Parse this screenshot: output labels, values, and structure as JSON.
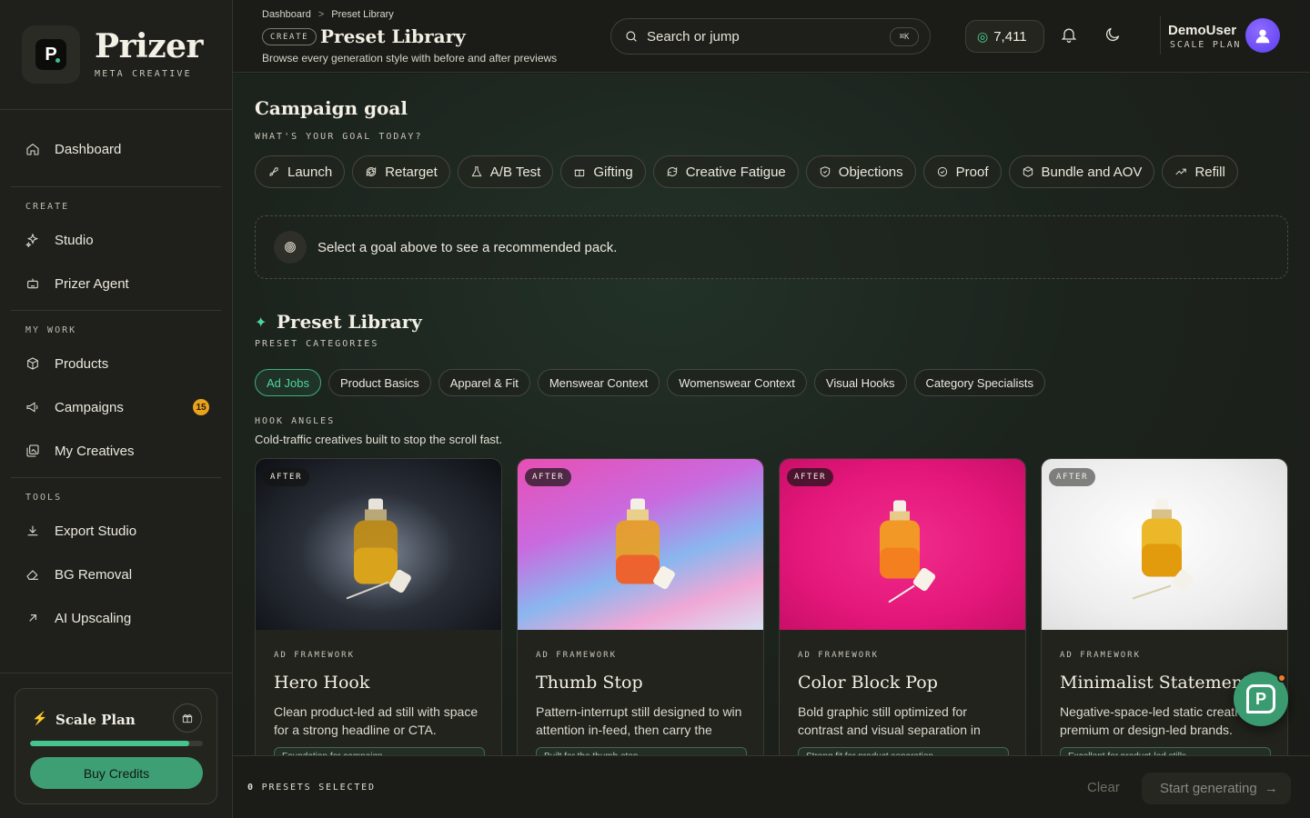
{
  "brand": {
    "name": "Prizer",
    "subtitle": "META CREATIVE",
    "logo_letter": "P"
  },
  "sidebar": {
    "dashboard": "Dashboard",
    "sections": [
      {
        "label": "CREATE",
        "items": [
          {
            "label": "Studio",
            "icon": "sparkle-icon"
          },
          {
            "label": "Prizer Agent",
            "icon": "robot-icon"
          }
        ]
      },
      {
        "label": "MY WORK",
        "items": [
          {
            "label": "Products",
            "icon": "box-icon"
          },
          {
            "label": "Campaigns",
            "icon": "megaphone-icon",
            "badge": "15"
          },
          {
            "label": "My Creatives",
            "icon": "gallery-icon"
          }
        ]
      },
      {
        "label": "TOOLS",
        "items": [
          {
            "label": "Export Studio",
            "icon": "download-icon"
          },
          {
            "label": "BG Removal",
            "icon": "eraser-icon"
          },
          {
            "label": "AI Upscaling",
            "icon": "arrow-up-right-icon"
          }
        ]
      }
    ],
    "plan": {
      "name": "Scale Plan",
      "progress_percent": 92,
      "buy_label": "Buy Credits"
    }
  },
  "header": {
    "breadcrumbs": [
      "Dashboard",
      "Preset Library"
    ],
    "breadcrumb_sep": ">",
    "pill": "CREATE",
    "title": "Preset Library",
    "subtitle": "Browse every generation style with before and after previews",
    "search_placeholder": "Search or jump",
    "shortcut": "⌘K",
    "credits": "7,411",
    "user_name": "DemoUser",
    "user_plan": "SCALE PLAN"
  },
  "goal": {
    "title": "Campaign goal",
    "caption": "WHAT'S YOUR GOAL TODAY?",
    "options": [
      "Launch",
      "Retarget",
      "A/B Test",
      "Gifting",
      "Creative Fatigue",
      "Objections",
      "Proof",
      "Bundle and AOV",
      "Refill"
    ],
    "hint": "Select a goal above to see a recommended pack."
  },
  "library": {
    "title": "Preset Library",
    "caption": "PRESET CATEGORIES",
    "categories": [
      "Ad Jobs",
      "Product Basics",
      "Apparel & Fit",
      "Menswear Context",
      "Womenswear Context",
      "Visual Hooks",
      "Category Specialists"
    ],
    "active_category": "Ad Jobs",
    "group_caption": "HOOK ANGLES",
    "group_desc": "Cold-traffic creatives built to stop the scroll fast.",
    "cards": [
      {
        "badge": "AFTER",
        "caption": "AD FRAMEWORK",
        "title": "Hero Hook",
        "desc": "Clean product-led ad still with space for a strong headline or CTA.",
        "note": "Foundation for campaign...",
        "bg": "#101318"
      },
      {
        "badge": "AFTER",
        "caption": "AD FRAMEWORK",
        "title": "Thumb Stop",
        "desc": "Pattern-interrupt still designed to win attention in-feed, then carry the message.",
        "note": "Built for the thumb-stop...",
        "bg": "#e15ab4"
      },
      {
        "badge": "AFTER",
        "caption": "AD FRAMEWORK",
        "title": "Color Block Pop",
        "desc": "Bold graphic still optimized for contrast and visual separation in feed.",
        "note": "Strong fit for product separation...",
        "bg": "#ec1a78"
      },
      {
        "badge": "AFTER",
        "caption": "AD FRAMEWORK",
        "title": "Minimalist Statement",
        "desc": "Negative-space-led static creative for premium or design-led brands.",
        "note": "Excellent for product-led stills...",
        "bg": "#eeeeee"
      }
    ]
  },
  "footer": {
    "count": "0",
    "count_label": "PRESETS SELECTED",
    "clear": "Clear",
    "start": "Start generating"
  }
}
